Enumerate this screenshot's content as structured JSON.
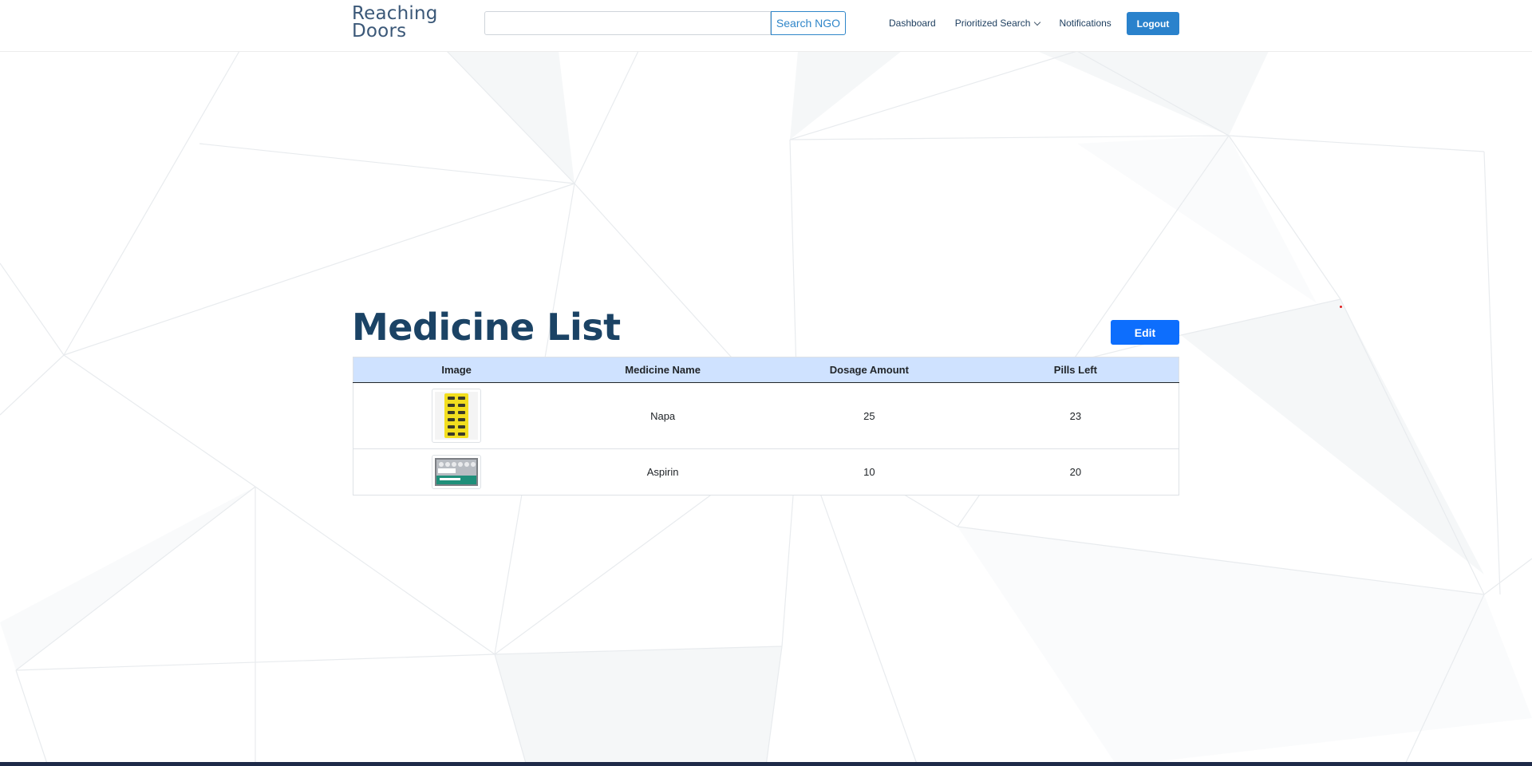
{
  "brand": {
    "line1": "Reaching",
    "line2": "Doors"
  },
  "search": {
    "value": "",
    "placeholder": "",
    "button_label": "Search NGO"
  },
  "nav": {
    "dashboard": "Dashboard",
    "prioritized_search": "Prioritized Search",
    "notifications": "Notifications",
    "logout": "Logout"
  },
  "page": {
    "title": "Medicine List",
    "edit_label": "Edit"
  },
  "table": {
    "headers": [
      "Image",
      "Medicine Name",
      "Dosage Amount",
      "Pills Left"
    ],
    "rows": [
      {
        "image": "napa-blister-pack-image",
        "name": "Napa",
        "dosage": "25",
        "pills_left": "23"
      },
      {
        "image": "aspirin-box-image",
        "name": "Aspirin",
        "dosage": "10",
        "pills_left": "20"
      }
    ]
  },
  "colors": {
    "brand_text": "#3b5878",
    "title": "#1b4365",
    "primary": "#0d6efd",
    "logout": "#2a82cc",
    "table_header": "#cfe2ff"
  },
  "icons": {
    "dropdown": "chevron-down-icon"
  }
}
